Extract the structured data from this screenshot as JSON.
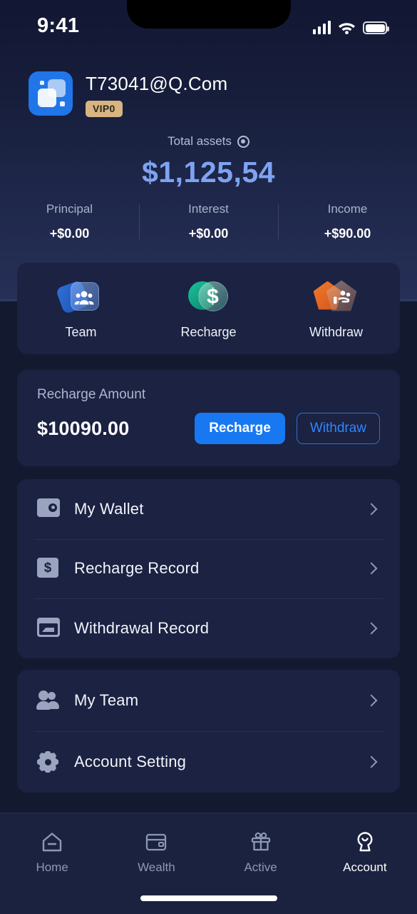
{
  "status_bar": {
    "time": "9:41",
    "signal_icon": "cellular-signal-icon",
    "wifi_icon": "wifi-icon",
    "battery_icon": "battery-full-icon"
  },
  "profile": {
    "avatar_icon": "app-logo-avatar",
    "username": "T73041@Q.Com",
    "vip_badge": "VIP0"
  },
  "assets": {
    "label": "Total assets",
    "toggle_icon": "eye-visibility-icon",
    "value": "$1,125,54",
    "value_color": "#7fa3f2",
    "stats": [
      {
        "label": "Principal",
        "value": "+$0.00"
      },
      {
        "label": "Interest",
        "value": "+$0.00"
      },
      {
        "label": "Income",
        "value": "+$90.00"
      }
    ]
  },
  "quick_actions": [
    {
      "label": "Team",
      "icon": "team-people-icon"
    },
    {
      "label": "Recharge",
      "icon": "recharge-dollar-icon"
    },
    {
      "label": "Withdraw",
      "icon": "withdraw-hand-icon"
    }
  ],
  "recharge_card": {
    "label": "Recharge Amount",
    "amount": "$10090.00",
    "primary_button": "Recharge",
    "secondary_button": "Withdraw",
    "primary_color": "#1778f2",
    "secondary_color": "#2f86ff"
  },
  "menu_group_one": [
    {
      "label": "My Wallet",
      "icon": "wallet-icon"
    },
    {
      "label": "Recharge Record",
      "icon": "dollar-note-icon"
    },
    {
      "label": "Withdrawal Record",
      "icon": "withdrawal-card-icon"
    }
  ],
  "menu_group_two": [
    {
      "label": "My Team",
      "icon": "people-group-icon"
    },
    {
      "label": "Account Setting",
      "icon": "gear-icon"
    }
  ],
  "tabbar": [
    {
      "label": "Home",
      "icon": "home-icon",
      "active": false
    },
    {
      "label": "Wealth",
      "icon": "wallet-icon",
      "active": false
    },
    {
      "label": "Active",
      "icon": "gift-icon",
      "active": false
    },
    {
      "label": "Account",
      "icon": "account-person-icon",
      "active": true
    }
  ]
}
